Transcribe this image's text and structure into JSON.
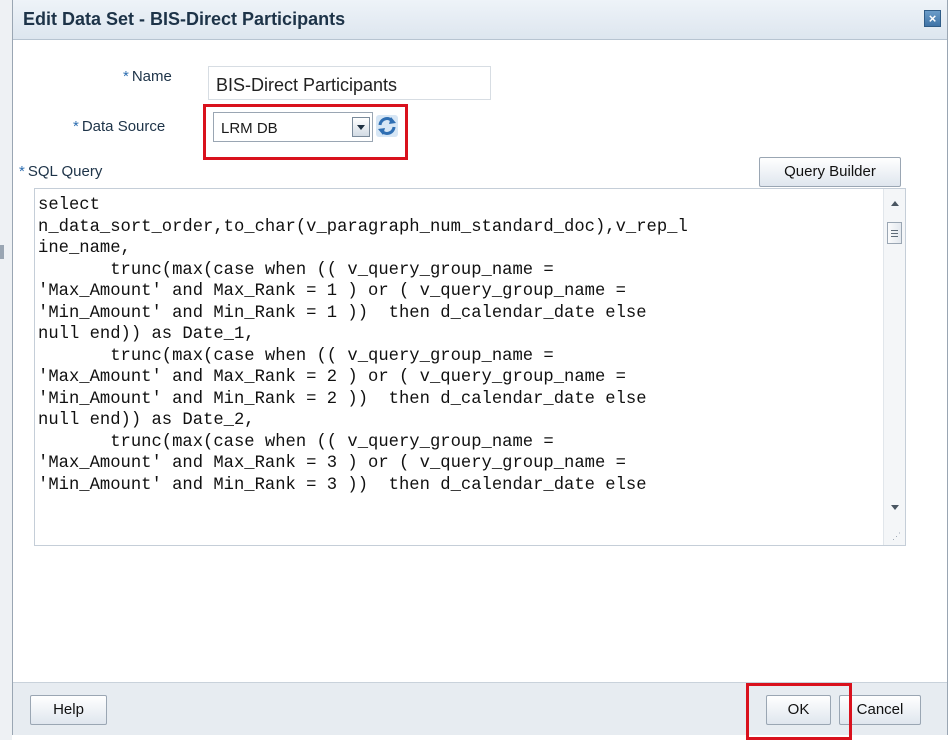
{
  "dialog": {
    "title": "Edit Data Set - BIS-Direct Participants",
    "close_symbol": "×"
  },
  "form": {
    "required_marker": "*",
    "name_label": "Name",
    "name_value": "BIS-Direct Participants",
    "data_source_label": "Data Source",
    "data_source_value": "LRM DB",
    "sql_query_label": "SQL Query",
    "query_builder_label": "Query Builder",
    "sql_text": "select\nn_data_sort_order,to_char(v_paragraph_num_standard_doc),v_rep_l\nine_name,\n       trunc(max(case when (( v_query_group_name =\n'Max_Amount' and Max_Rank = 1 ) or ( v_query_group_name =\n'Min_Amount' and Min_Rank = 1 ))  then d_calendar_date else\nnull end)) as Date_1,\n       trunc(max(case when (( v_query_group_name =\n'Max_Amount' and Max_Rank = 2 ) or ( v_query_group_name =\n'Min_Amount' and Min_Rank = 2 ))  then d_calendar_date else\nnull end)) as Date_2,\n       trunc(max(case when (( v_query_group_name =\n'Max_Amount' and Max_Rank = 3 ) or ( v_query_group_name =\n'Min_Amount' and Min_Rank = 3 ))  then d_calendar_date else"
  },
  "footer": {
    "help_label": "Help",
    "ok_label": "OK",
    "cancel_label": "Cancel"
  },
  "icons": {
    "close": "close-icon",
    "dropdown": "chevron-down-icon",
    "refresh": "refresh-icon"
  },
  "colors": {
    "highlight": "#d9111d",
    "required": "#2c6db0",
    "title_text": "#1d3348"
  }
}
